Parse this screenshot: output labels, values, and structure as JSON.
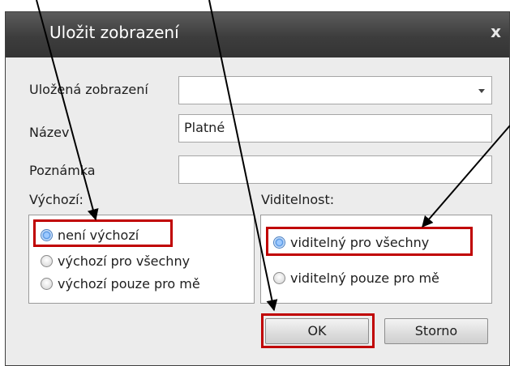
{
  "dialog": {
    "title": "Uložit zobrazení",
    "close_label": "x"
  },
  "form": {
    "saved_views_label": "Uložená zobrazení",
    "saved_views_value": "",
    "name_label": "Název",
    "name_value": "Platné",
    "note_label": "Poznámka",
    "note_value": ""
  },
  "default_group": {
    "label": "Výchozí:",
    "options": [
      {
        "label": "není výchozí",
        "checked": true
      },
      {
        "label": "výchozí pro všechny",
        "checked": false
      },
      {
        "label": "výchozí pouze pro mě",
        "checked": false
      }
    ]
  },
  "visibility_group": {
    "label": "Viditelnost:",
    "options": [
      {
        "label": "viditelný pro všechny",
        "checked": true
      },
      {
        "label": "viditelný pouze pro mě",
        "checked": false
      }
    ]
  },
  "buttons": {
    "ok_label": "OK",
    "cancel_label": "Storno"
  },
  "colors": {
    "title_bar": "#3d3d3d",
    "highlight": "#c00000",
    "arrow": "#000000"
  }
}
